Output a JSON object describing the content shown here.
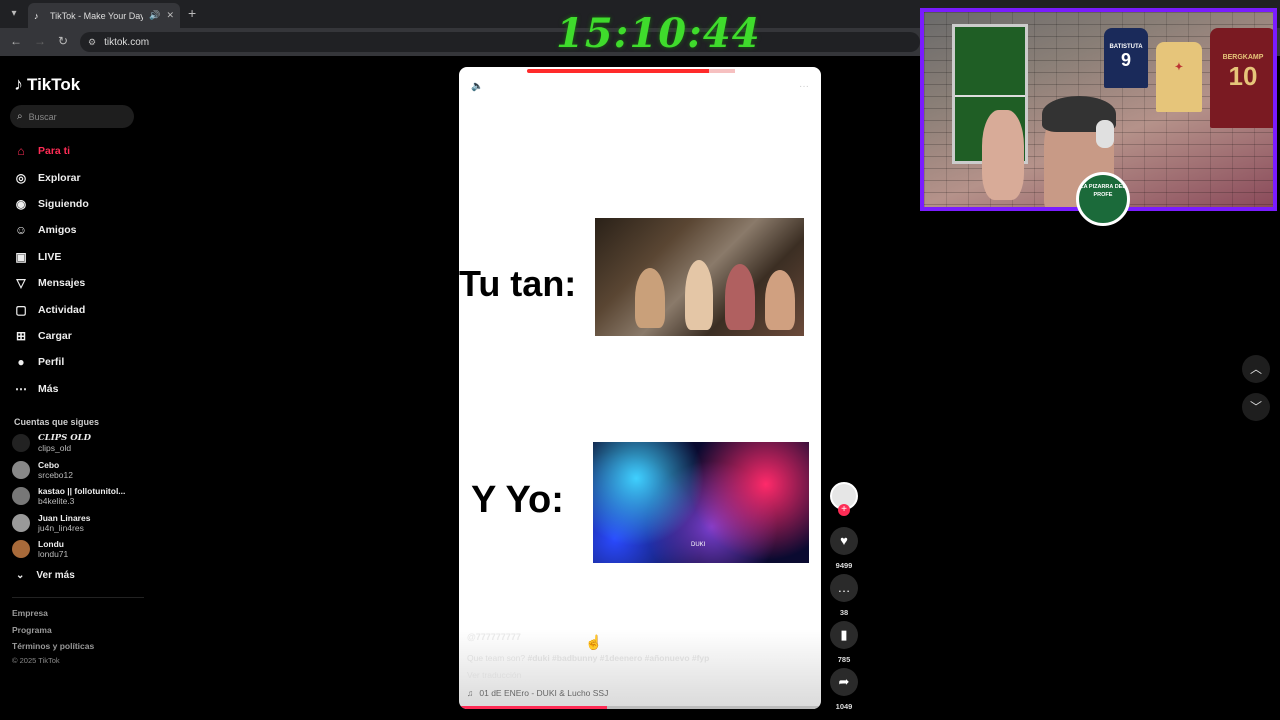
{
  "browser": {
    "tab_title": "TikTok - Make Your Day",
    "url": "tiktok.com"
  },
  "overlay": {
    "clock": "15:10:44"
  },
  "sidebar": {
    "logo": "TikTok",
    "search_placeholder": "Buscar",
    "items": [
      {
        "label": "Para ti",
        "icon": "home-icon"
      },
      {
        "label": "Explorar",
        "icon": "compass-icon"
      },
      {
        "label": "Siguiendo",
        "icon": "following-icon"
      },
      {
        "label": "Amigos",
        "icon": "friends-icon"
      },
      {
        "label": "LIVE",
        "icon": "live-icon"
      },
      {
        "label": "Mensajes",
        "icon": "messages-icon"
      },
      {
        "label": "Actividad",
        "icon": "activity-icon"
      },
      {
        "label": "Cargar",
        "icon": "upload-icon"
      },
      {
        "label": "Perfil",
        "icon": "profile-icon"
      },
      {
        "label": "Más",
        "icon": "more-icon"
      }
    ],
    "following_title": "Cuentas que sigues",
    "accounts": [
      {
        "name": "CLIPS OLD",
        "user": "clips_old"
      },
      {
        "name": "Cebo",
        "user": "srcebo12"
      },
      {
        "name": "kastao || follotunitol...",
        "user": "b4kelite.3"
      },
      {
        "name": "Juan Linares",
        "user": "ju4n_lin4res"
      },
      {
        "name": "Londu",
        "user": "londu71"
      }
    ],
    "see_more": "Ver más",
    "footer": [
      "Empresa",
      "Programa",
      "Términos y políticas"
    ],
    "copyright": "© 2025 TikTok"
  },
  "video": {
    "caption_top": "Tu tan:",
    "caption_bottom": "Y Yo:",
    "image_label": "DUKI",
    "username": "@777777777",
    "description_prefix": "Que team son?",
    "hashtags": "#duki #badbunny #1deenero #añonuevo #fyp",
    "translate": "Ver traducción",
    "sound": "01 dE ENEro - DUKI & Lucho SSJ",
    "progress": 0.41
  },
  "actions": {
    "likes": "9499",
    "comments": "38",
    "saves": "785",
    "shares": "1049"
  },
  "webcam": {
    "jersey1": "9",
    "jersey1_name": "BATISTUTA",
    "jersey3": "10",
    "jersey3_name": "BERGKAMP",
    "logo_text": "LA PIZARRA DEL PROFE"
  },
  "colors": {
    "accent": "#fe2c55",
    "clock": "#3fdc2c",
    "cam_border": "#7a1cff"
  }
}
